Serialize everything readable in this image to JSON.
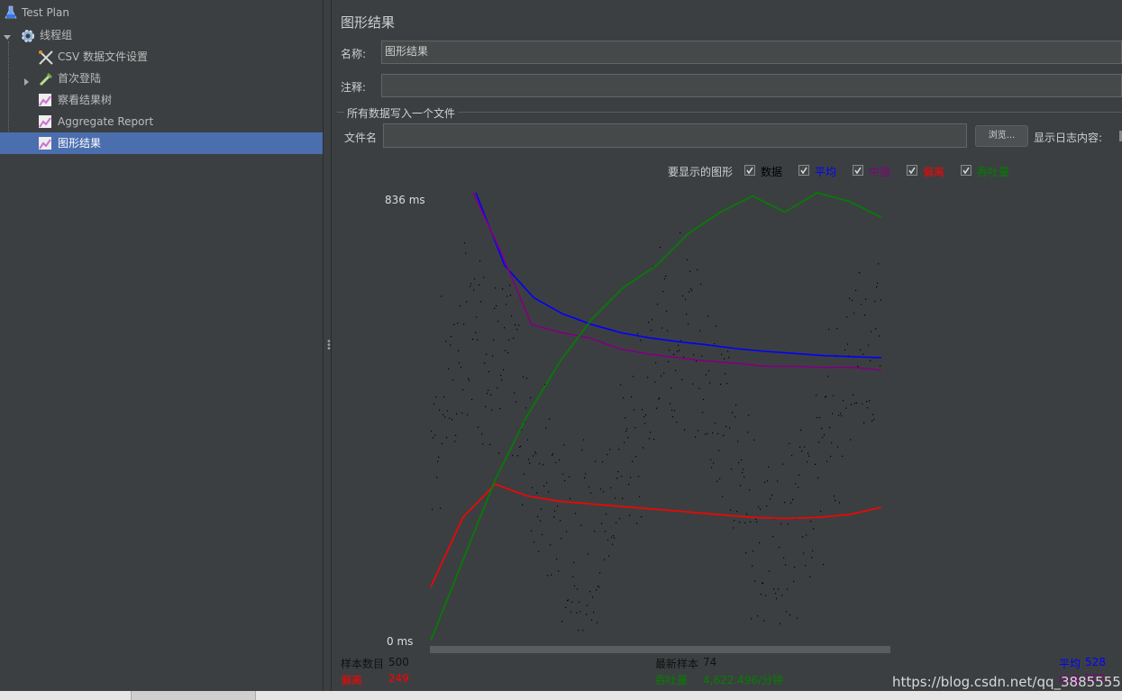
{
  "tree": {
    "items": [
      {
        "label": "Test Plan"
      },
      {
        "label": "线程组"
      },
      {
        "label": "CSV 数据文件设置"
      },
      {
        "label": "首次登陆"
      },
      {
        "label": "察看结果树"
      },
      {
        "label": "Aggregate Report"
      },
      {
        "label": "图形结果"
      }
    ]
  },
  "panel": {
    "title": "图形结果",
    "name_label": "名称:",
    "name_value": "图形结果",
    "comment_label": "注释:",
    "comment_value": "",
    "group_title": "所有数据写入一个文件",
    "filename_label": "文件名",
    "filename_value": "",
    "browse_label": "浏览...",
    "log_label": "显示日志内容:"
  },
  "graph_options": {
    "label": "要显示的图形",
    "options": [
      {
        "label": "数据",
        "checked": true,
        "color": "#000000"
      },
      {
        "label": "平均",
        "checked": true,
        "color": "#0000ff"
      },
      {
        "label": "中值",
        "checked": true,
        "color": "#800080"
      },
      {
        "label": "偏离",
        "checked": true,
        "color": "#ff0000"
      },
      {
        "label": "吞吐量",
        "checked": true,
        "color": "#008000"
      }
    ]
  },
  "chart_data": {
    "type": "line",
    "ylim": [
      0,
      836
    ],
    "y_max_label": "836",
    "y_min_label": "0",
    "y_unit": "ms",
    "samples": 500,
    "series": [
      {
        "name": "平均",
        "color": "#0000ff",
        "values": [
          836,
          700,
          640,
          610,
          590,
          575,
          565,
          558,
          552,
          545,
          540,
          536,
          532,
          530,
          528
        ]
      },
      {
        "name": "中值",
        "color": "#800080",
        "values": [
          836,
          720,
          590,
          575,
          565,
          545,
          535,
          528,
          522,
          518,
          512,
          512,
          510,
          510,
          505
        ]
      },
      {
        "name": "偏离",
        "color": "#ff0000",
        "values": [
          100,
          230,
          292,
          270,
          260,
          255,
          250,
          245,
          240,
          235,
          230,
          228,
          230,
          235,
          249
        ]
      },
      {
        "name": "吞吐量",
        "color": "#008000",
        "values": [
          0,
          150,
          300,
          420,
          520,
          600,
          660,
          700,
          760,
          800,
          830,
          800,
          836,
          820,
          790
        ]
      }
    ]
  },
  "stats": {
    "samples_label": "样本数目",
    "samples_value": "500",
    "latest_label": "最新样本",
    "latest_value": "74",
    "avg_label": "平均",
    "avg_value": "528",
    "deviation_label": "偏离",
    "deviation_value": "249",
    "throughput_label": "吞吐量",
    "throughput_value": "4,622.496/分钟",
    "median_label": "中值",
    "median_value": "505"
  },
  "watermark": "https://blog.csdn.net/qq_38855557"
}
